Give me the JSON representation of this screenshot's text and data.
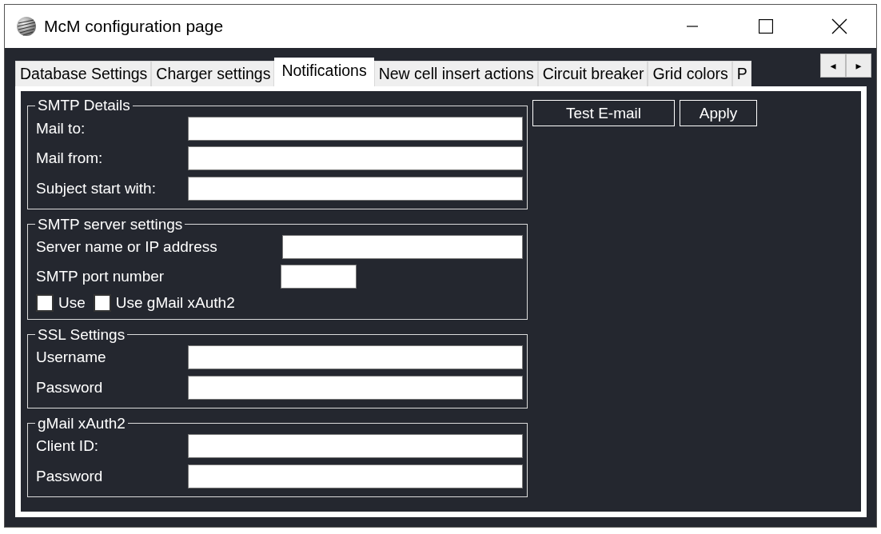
{
  "window": {
    "title": "McM configuration page"
  },
  "tabs": [
    {
      "label": "Database Settings",
      "selected": false
    },
    {
      "label": "Charger settings",
      "selected": false
    },
    {
      "label": "Notifications",
      "selected": true
    },
    {
      "label": "New cell insert actions",
      "selected": false
    },
    {
      "label": "Circuit breaker",
      "selected": false
    },
    {
      "label": "Grid colors",
      "selected": false
    },
    {
      "label": "P",
      "selected": false
    }
  ],
  "tab_scroll": {
    "left": "◂",
    "right": "▸"
  },
  "groups": [
    {
      "title": "SMTP Details",
      "kind": "fields",
      "rows": [
        {
          "label": "Mail to:",
          "kind": "wide"
        },
        {
          "label": "Mail from:",
          "kind": "wide"
        },
        {
          "label": "Subject start with:",
          "kind": "wide"
        }
      ]
    },
    {
      "title": "SMTP server settings",
      "kind": "server",
      "rows": [
        {
          "label": "Server name or IP address",
          "kind": "wide"
        },
        {
          "label": "SMTP port number",
          "kind": "short"
        }
      ],
      "checkboxes": [
        {
          "label": "Use",
          "checked": false
        },
        {
          "label": "Use gMail xAuth2",
          "checked": false
        }
      ]
    },
    {
      "title": "SSL Settings",
      "kind": "fields",
      "rows": [
        {
          "label": "Username",
          "kind": "wide"
        },
        {
          "label": "Password",
          "kind": "wide"
        }
      ]
    },
    {
      "title": "gMail xAuth2",
      "kind": "fields",
      "rows": [
        {
          "label": "Client ID:",
          "kind": "wide"
        },
        {
          "label": "Password",
          "kind": "wide"
        }
      ]
    }
  ],
  "buttons": [
    "Test E-mail",
    "Apply"
  ]
}
